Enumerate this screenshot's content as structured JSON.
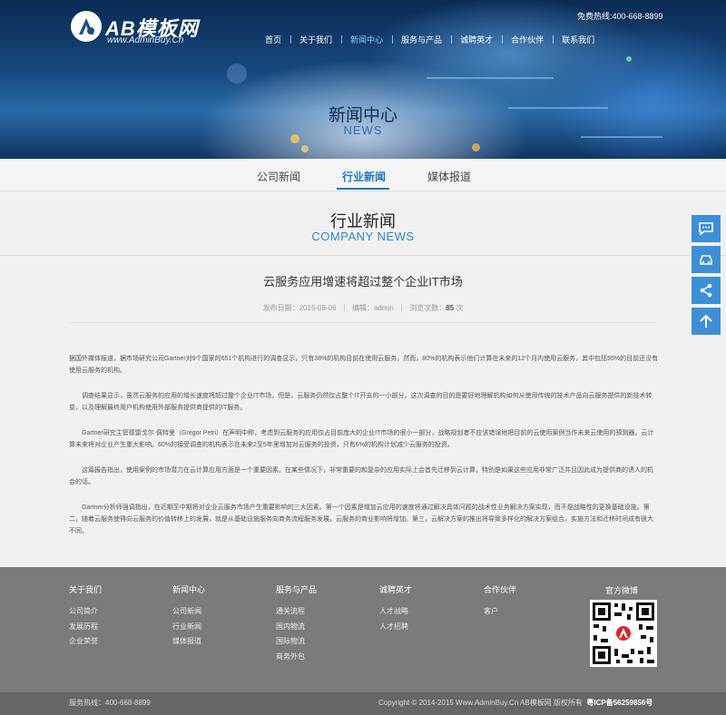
{
  "brand": {
    "logo_title": "AB模板网",
    "logo_sub": "www.AdminBuy.Cn"
  },
  "header": {
    "hotline": "免费热线:400-668-8899",
    "nav": [
      "首页",
      "关于我们",
      "新闻中心",
      "服务与产品",
      "诚聘英才",
      "合作伙伴",
      "联系我们"
    ],
    "active_nav": "新闻中心"
  },
  "banner": {
    "title": "新闻中心",
    "subtitle": "NEWS"
  },
  "tabs": {
    "items": [
      "公司新闻",
      "行业新闻",
      "媒体报道"
    ],
    "active": "行业新闻"
  },
  "section": {
    "title": "行业新闻",
    "subtitle": "COMPANY NEWS"
  },
  "article": {
    "title": "云服务应用增速将超过整个企业IT市场",
    "date_label": "发布日期：",
    "date": "2015-08-06",
    "editor_label": "编辑：",
    "editor": "admin",
    "views_label": "浏览次数：",
    "views": "85",
    "views_unit": "次",
    "paragraphs": [
      "据国外媒体报道，据市场研究公司Gartner对9个国家的651个机构进行的调查显示，只有38%的机构目前在使用云服务。然而，80%的机构表示他们计算在未来的12个月内使用云服务，其中包括55%的目前还没有使用云服务的机构。",
      "调查结果显示，虽然云服务的应用的增长速度将超过整个企业IT市场，但是，云服务仍然仅占整个IT开支的一小部分。这次调查的目的是要好地理解机构如何从使用传统的技术产品向云服务提供的新技术转变，以及理解最终用户机构使用外部服务提供商提供的IT服务。",
      "Gartner研究主管德雷戈尔·佩特里（Gregor Petri）在声明中称，考虑到云服务的应用仅占目前庞大的企业IT市场的很小一部分，战略规划者不应该错误地把目前的云使用案例当作未来云使用的预测器。云计算未来将对企业产生重大影响。60%的接受调查的机构表示在未来2至5年里增加对云服务的投资，只有6%的机构计划减少云服务的投资。",
      "这篇报告指出，使用案例的市场潜力在云计算应用方面是一个重要因素。在某些情况下，非常重要的和复杂的应用实际上会首先迁移到云计算，特别是如果这些应用非常广泛并且因此成为提供商的诱人的机会的话。",
      "Gartner分析师强调指出，在近期至中期将对企业云服务市场产生重要影响的三大因素。第一个因素是增加云应用的速度将通过解决具体问题的战术性业务解决方案实现，而不是战略性的更换基础设施。第二，随着云服务使得向云服务的价值转移上的发展，就是从基础设施服务向商务流程服务发展，云服务的商业影响将增加。第三，云解决方案的推出将导致多样化的解决方案组合，实施方法和迁移时间成有很大不同。"
    ]
  },
  "footer": {
    "columns": [
      {
        "title": "关于我们",
        "links": [
          "公司简介",
          "发展历程",
          "企业荣誉"
        ]
      },
      {
        "title": "新闻中心",
        "links": [
          "公司新闻",
          "行业新闻",
          "媒体报道"
        ]
      },
      {
        "title": "服务与产品",
        "links": [
          "通关流程",
          "国内物流",
          "国际物流",
          "商务外包"
        ]
      },
      {
        "title": "诚聘英才",
        "links": [
          "人才战略",
          "人才招聘"
        ]
      },
      {
        "title": "合作伙伴",
        "links": [
          "客户"
        ]
      }
    ],
    "weibo_title": "官方微博",
    "hotline": "服务热线：400-668-8899",
    "copyright": "Copyright © 2014-2015 Www.AdminBuy.Cn AB模板网 版权所有",
    "icp": "粤ICP备56259856号"
  },
  "side_buttons": [
    "chat-icon",
    "car-icon",
    "share-icon",
    "back-to-top-icon"
  ],
  "colors": {
    "accent": "#1a76c7",
    "side_button": "#3d8fd6",
    "footer_bg": "#7b7b7b",
    "copyright_bg": "#666666"
  }
}
